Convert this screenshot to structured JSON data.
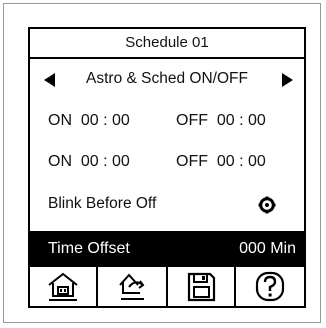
{
  "header": {
    "title": "Schedule 01"
  },
  "mode": {
    "label": "Astro & Sched ON/OFF"
  },
  "schedules": [
    {
      "on": "ON  00 : 00",
      "off": "OFF  00 : 00"
    },
    {
      "on": "ON  00 : 00",
      "off": "OFF  00 : 00"
    }
  ],
  "blink": {
    "label": "Blink Before Off",
    "icon": "gear-icon"
  },
  "offset": {
    "label": "Time Offset",
    "value": "000 Min"
  },
  "footer": {
    "icons": [
      "home-icon",
      "back-icon",
      "save-icon",
      "help-icon"
    ]
  }
}
